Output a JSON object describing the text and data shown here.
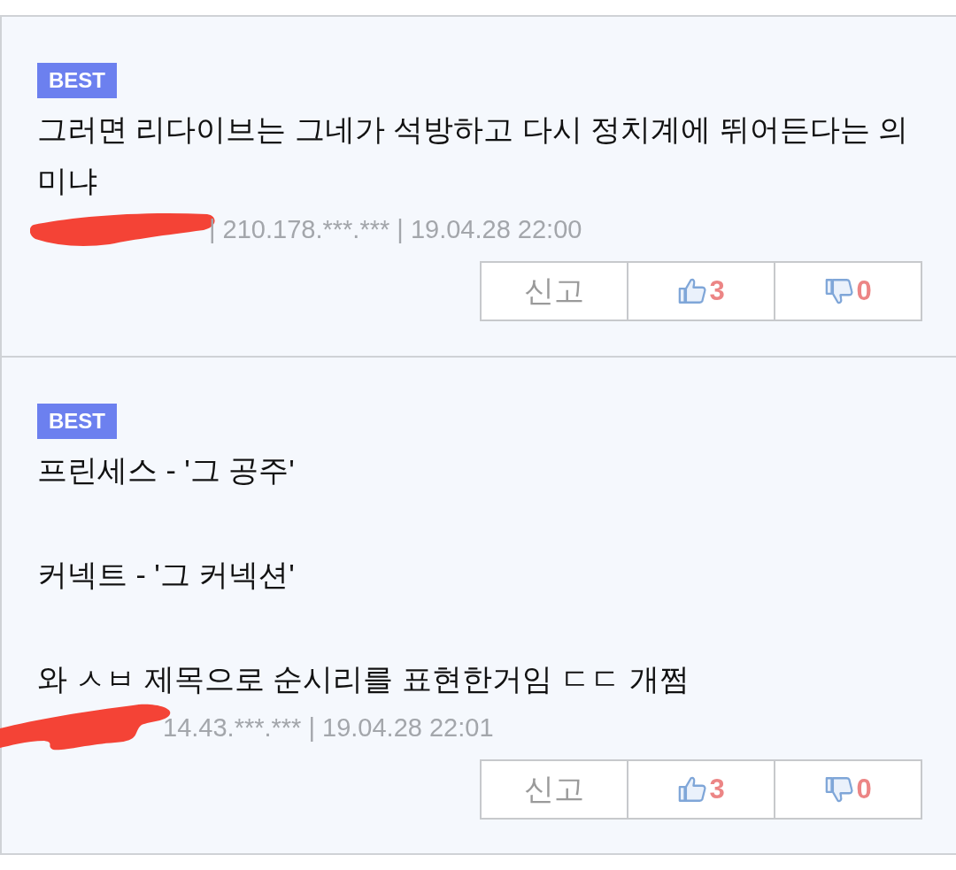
{
  "comments": [
    {
      "badge": "BEST",
      "lines": [
        "그러면 리다이브는 그네가 석방하고 다시 정치계에 뛰어든다는 의미냐"
      ],
      "meta": "| 210.178.***.*** | 19.04.28 22:00",
      "report": "신고",
      "likes": "3",
      "dislikes": "0"
    },
    {
      "badge": "BEST",
      "lines": [
        "프린세스 - '그 공주'",
        "커넥트 - '그 커넥션'",
        "와 ㅅㅂ 제목으로 순시리를 표현한거임 ㄷㄷ 개쩜"
      ],
      "meta": "14.43.***.*** | 19.04.28 22:01",
      "report": "신고",
      "likes": "3",
      "dislikes": "0"
    }
  ]
}
